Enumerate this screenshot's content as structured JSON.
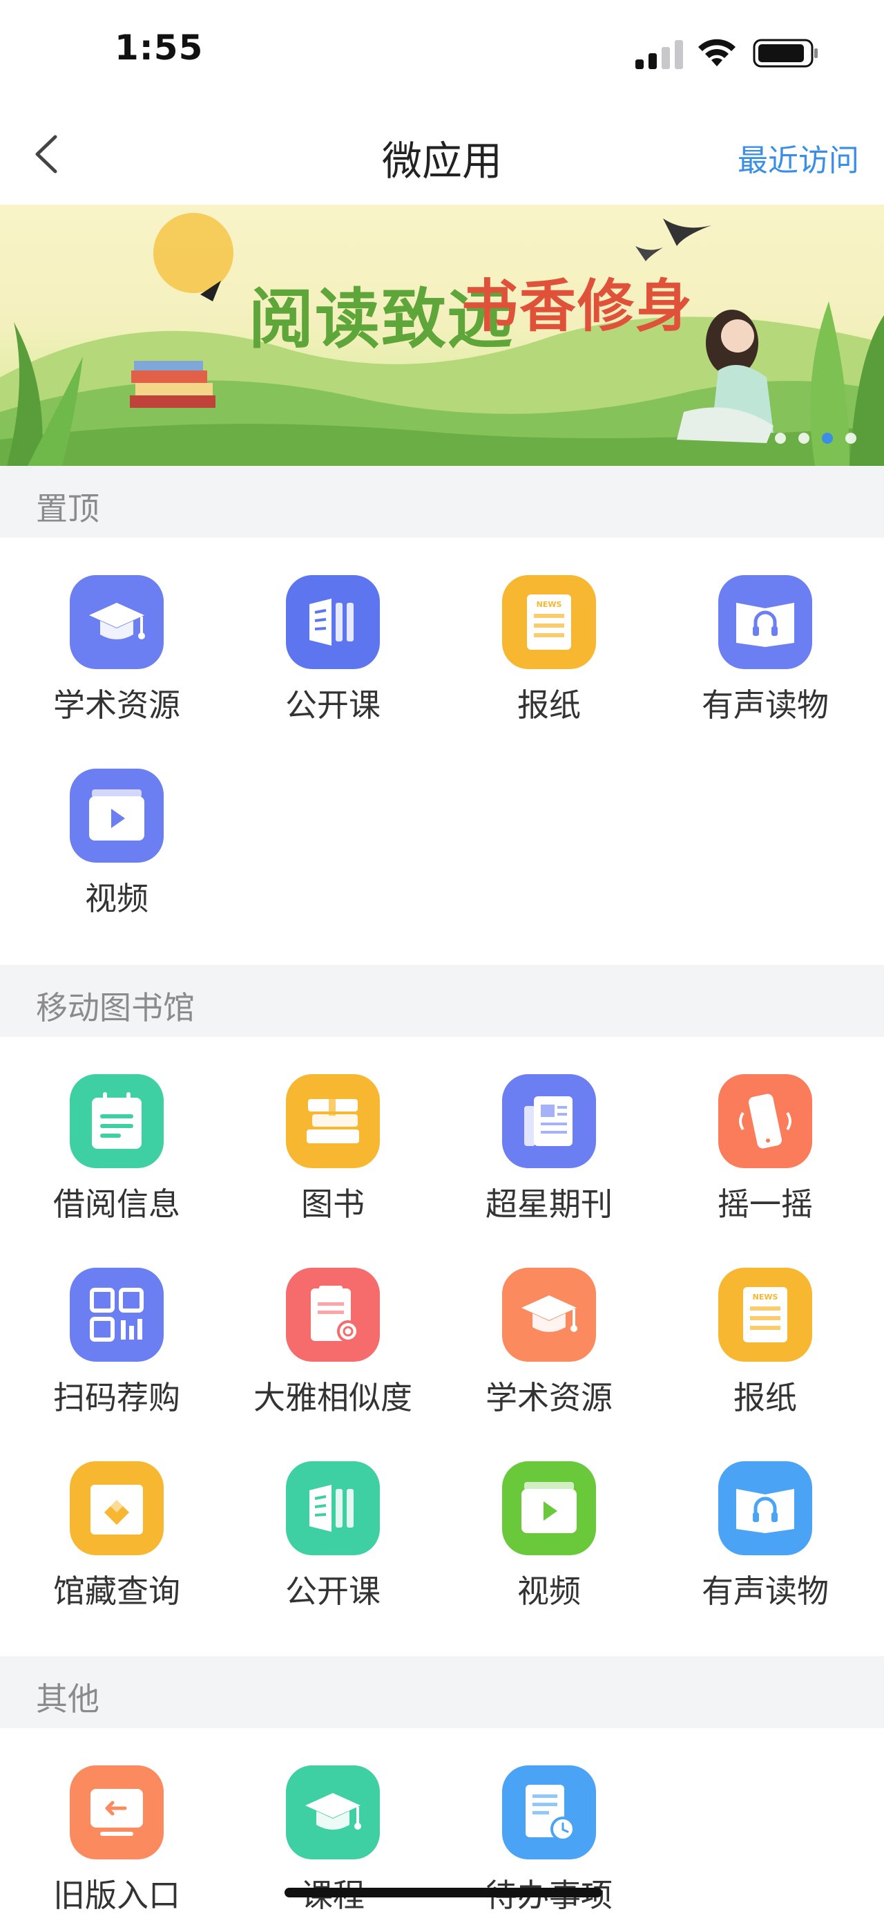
{
  "status_bar": {
    "time": "1:55"
  },
  "nav": {
    "title": "微应用",
    "recent_label": "最近访问"
  },
  "banner": {
    "slogan_part1": "阅读致远",
    "slogan_part2": "书香修身",
    "slide_count": 4,
    "active_slide": 3
  },
  "sections": [
    {
      "title": "置顶",
      "items": [
        {
          "label": "学术资源",
          "icon": "graduation-cap-icon",
          "color": "#6b7ef2"
        },
        {
          "label": "公开课",
          "icon": "book-columns-icon",
          "color": "#5d76f0"
        },
        {
          "label": "报纸",
          "icon": "newspaper-icon",
          "color": "#f7b731"
        },
        {
          "label": "有声读物",
          "icon": "audiobook-icon",
          "color": "#6b7ef2"
        },
        {
          "label": "视频",
          "icon": "video-play-icon",
          "color": "#6b7ef2"
        }
      ]
    },
    {
      "title": "移动图书馆",
      "items": [
        {
          "label": "借阅信息",
          "icon": "calendar-icon",
          "color": "#3ecfa3"
        },
        {
          "label": "图书",
          "icon": "books-icon",
          "color": "#f7b731"
        },
        {
          "label": "超星期刊",
          "icon": "journal-icon",
          "color": "#6b7ef2"
        },
        {
          "label": "摇一摇",
          "icon": "shake-phone-icon",
          "color": "#fb7c5a"
        },
        {
          "label": "扫码荐购",
          "icon": "qr-code-icon",
          "color": "#6b7ef2"
        },
        {
          "label": "大雅相似度",
          "icon": "document-search-icon",
          "color": "#f66b6b"
        },
        {
          "label": "学术资源",
          "icon": "graduation-cap-icon",
          "color": "#fb8a5e"
        },
        {
          "label": "报纸",
          "icon": "newspaper-icon",
          "color": "#f7b731"
        },
        {
          "label": "馆藏查询",
          "icon": "collection-icon",
          "color": "#f7b731"
        },
        {
          "label": "公开课",
          "icon": "book-columns-icon",
          "color": "#3ecfa3"
        },
        {
          "label": "视频",
          "icon": "video-play-icon",
          "color": "#69c93a"
        },
        {
          "label": "有声读物",
          "icon": "audiobook-icon",
          "color": "#4aa3f5"
        }
      ]
    },
    {
      "title": "其他",
      "items": [
        {
          "label": "旧版入口",
          "icon": "old-version-icon",
          "color": "#fb8a5e"
        },
        {
          "label": "课程",
          "icon": "graduation-cap-icon",
          "color": "#3ecfa3"
        },
        {
          "label": "待办事项",
          "icon": "todo-clock-icon",
          "color": "#4aa3f5"
        }
      ]
    }
  ]
}
